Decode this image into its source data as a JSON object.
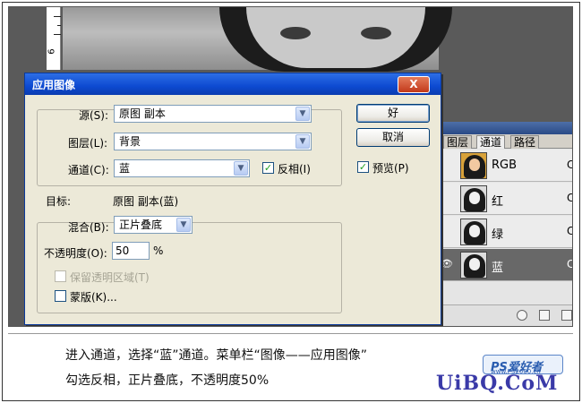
{
  "dialog": {
    "title": "应用图像",
    "close_glyph": "X",
    "source": {
      "label": "源(S):",
      "value": "原图 副本"
    },
    "layer": {
      "label": "图层(L):",
      "value": "背景"
    },
    "channel": {
      "label": "通道(C):",
      "value": "蓝"
    },
    "invert": {
      "label": "反相(I)",
      "checked": true
    },
    "target": {
      "label": "目标:",
      "value": "原图 副本(蓝)"
    },
    "blending": {
      "label": "混合(B):",
      "value": "正片叠底"
    },
    "opacity": {
      "label": "不透明度(O):",
      "value": "50",
      "unit": "%"
    },
    "preserve_transparency": {
      "label": "保留透明区域(T)",
      "checked": false,
      "enabled": false
    },
    "mask": {
      "label": "蒙版(K)...",
      "checked": false
    },
    "ok_label": "好",
    "cancel_label": "取消",
    "preview": {
      "label": "预览(P)",
      "checked": true
    },
    "checkmark": "✓",
    "dropdown_arrow": "▼"
  },
  "ruler": {
    "number": "6"
  },
  "panel": {
    "tabs": [
      "图层",
      "通道",
      "路径"
    ],
    "active_tab": "通道",
    "channels": [
      {
        "label": "RGB",
        "shortcut": "C",
        "selected": false,
        "visible": false
      },
      {
        "label": "红",
        "shortcut": "C",
        "selected": false,
        "visible": false
      },
      {
        "label": "绿",
        "shortcut": "C",
        "selected": false,
        "visible": false
      },
      {
        "label": "蓝",
        "shortcut": "C",
        "selected": true,
        "visible": true
      }
    ],
    "eye_glyph": "👁"
  },
  "caption": {
    "line1": "进入通道，选择“蓝”通道。菜单栏“图像——应用图像”",
    "line2": "勾选反相，正片叠底，不透明度50%"
  },
  "watermark": {
    "logo_text": "PS爱好者",
    "logo_url": "www.PS2000.cn",
    "site": "UiBQ.CoM"
  },
  "colors": {
    "titlebar": "#0d4ad1",
    "dialog_bg": "#ece9d8",
    "selected_channel": "#686868"
  }
}
